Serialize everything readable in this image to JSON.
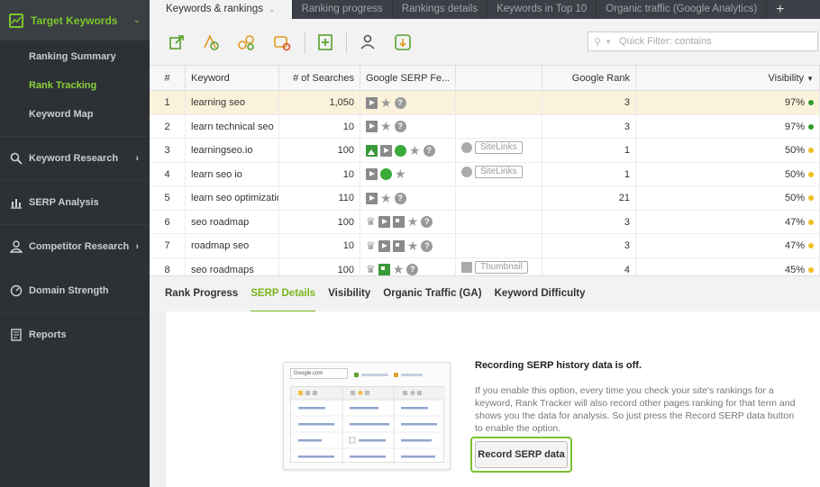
{
  "sidebar": {
    "header": "Target Keywords",
    "sub_items": [
      "Ranking Summary",
      "Rank Tracking",
      "Keyword Map"
    ],
    "active_sub": "Rank Tracking",
    "sections": [
      {
        "label": "Keyword Research",
        "icon": "search-icon",
        "has_arrow": true
      },
      {
        "label": "SERP Analysis",
        "icon": "bar-chart-icon",
        "has_arrow": false
      },
      {
        "label": "Competitor Research",
        "icon": "user-icon",
        "has_arrow": true
      },
      {
        "label": "Domain Strength",
        "icon": "gauge-icon",
        "has_arrow": false
      },
      {
        "label": "Reports",
        "icon": "document-icon",
        "has_arrow": false
      }
    ]
  },
  "tabs": [
    "Keywords & rankings",
    "Ranking progress",
    "Rankings details",
    "Keywords in Top 10",
    "Organic traffic (Google Analytics)"
  ],
  "tab_plus": "+",
  "filter": {
    "placeholder": "Quick Filter: contains"
  },
  "table": {
    "headers": {
      "num": "#",
      "keyword": "Keyword",
      "searches": "# of Searches",
      "features": "Google SERP Fe...",
      "rank": "Google Rank",
      "visibility": "Visibility"
    },
    "rows": [
      {
        "num": "1",
        "keyword": "learning seo",
        "searches": "1,050",
        "features": [
          "play",
          "star",
          "q"
        ],
        "extra": "",
        "rank": "3",
        "visibility": "97%",
        "dot": "#2e9d2e"
      },
      {
        "num": "2",
        "keyword": "learn technical seo",
        "searches": "10",
        "features": [
          "play",
          "star",
          "q"
        ],
        "extra": "",
        "rank": "3",
        "visibility": "97%",
        "dot": "#2e9d2e"
      },
      {
        "num": "3",
        "keyword": "learningseo.io",
        "searches": "100",
        "features": [
          "img",
          "play",
          "link",
          "star",
          "q"
        ],
        "extra": "SiteLinks",
        "rank": "1",
        "visibility": "50%",
        "dot": "#f0c020"
      },
      {
        "num": "4",
        "keyword": "learn seo io",
        "searches": "10",
        "features": [
          "play",
          "link",
          "star"
        ],
        "extra": "SiteLinks",
        "rank": "1",
        "visibility": "50%",
        "dot": "#f0c020"
      },
      {
        "num": "5",
        "keyword": "learn seo optimization",
        "searches": "110",
        "features": [
          "play",
          "star",
          "q"
        ],
        "extra": "",
        "rank": "21",
        "visibility": "50%",
        "dot": "#f0c020"
      },
      {
        "num": "6",
        "keyword": "seo roadmap",
        "searches": "100",
        "features": [
          "crown",
          "play",
          "box",
          "star",
          "q"
        ],
        "extra": "",
        "rank": "3",
        "visibility": "47%",
        "dot": "#f0c020"
      },
      {
        "num": "7",
        "keyword": "roadmap seo",
        "searches": "10",
        "features": [
          "crown",
          "play",
          "box",
          "star",
          "q"
        ],
        "extra": "",
        "rank": "3",
        "visibility": "47%",
        "dot": "#f0c020"
      },
      {
        "num": "8",
        "keyword": "seo roadmaps",
        "searches": "100",
        "features": [
          "crown",
          "boxg",
          "star",
          "q"
        ],
        "extra": "Thumbnail",
        "rank": "4",
        "visibility": "45%",
        "dot": "#f0c020"
      }
    ]
  },
  "bottom_tabs": [
    "Rank Progress",
    "SERP Details",
    "Visibility",
    "Organic Traffic (GA)",
    "Keyword Difficulty"
  ],
  "active_bottom_tab": "SERP Details",
  "panel": {
    "illustration_label": "Google.com",
    "title": "Recording SERP history data is off.",
    "text": "If you enable this option, every time you check your site's rankings for a keyword, Rank Tracker will also record other pages ranking for that term and shows you the data for analysis. So just press the Record SERP data button to enable the option.",
    "button": "Record SERP data"
  }
}
